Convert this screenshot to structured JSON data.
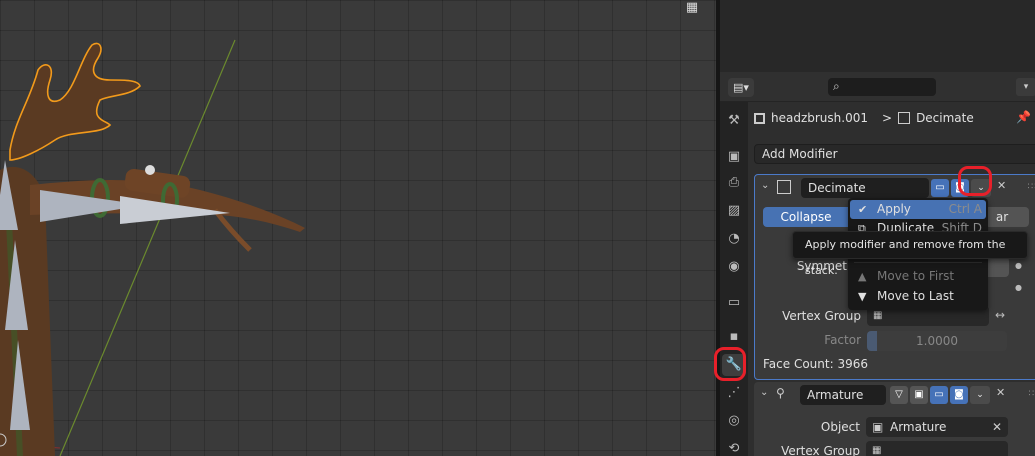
{
  "properties": {
    "breadcrumb": {
      "object": "headzbrush.001",
      "separator": ">",
      "modifier": "Decimate"
    },
    "add_modifier": "Add Modifier",
    "decimate_panel": {
      "name": "Decimate",
      "mode_collapse": "Collapse",
      "mode_planar_partial": "ar",
      "symmetry_label_partial": "Symmet",
      "vertex_group_label": "Vertex Group",
      "factor_label": "Factor",
      "factor_value": "1.0000",
      "face_count": "Face Count: 3966"
    },
    "armature_panel": {
      "name": "Armature",
      "object_label": "Object",
      "object_value": "Armature",
      "vertex_group_label": "Vertex Group"
    }
  },
  "context_menu": {
    "items": [
      {
        "label": "Apply",
        "shortcut": "Ctrl A",
        "icon": "check-icon",
        "active": true
      },
      {
        "label": "Duplicate",
        "shortcut": "Shift D",
        "icon": "duplicate-icon"
      },
      {
        "label": "Move to First",
        "shortcut": "",
        "icon": "triangle-up-icon",
        "disabled": true
      },
      {
        "label": "Move to Last",
        "shortcut": "",
        "icon": "triangle-down-icon"
      }
    ]
  },
  "tooltip": "Apply modifier and remove from the stack.",
  "colors": {
    "accent": "#4772b3",
    "annotation": "#e8202a",
    "selection_outline": "#f29a1b"
  }
}
